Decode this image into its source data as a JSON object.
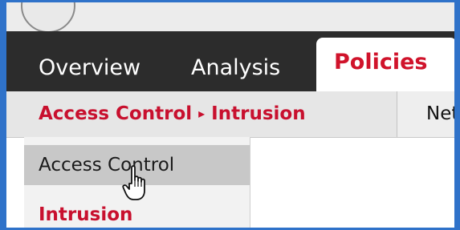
{
  "nav": {
    "tabs": [
      {
        "label": "Overview"
      },
      {
        "label": "Analysis"
      },
      {
        "label": "Policies"
      }
    ]
  },
  "breadcrumb": {
    "parent": "Access Control",
    "separator": "▸",
    "current": "Intrusion"
  },
  "subnav": {
    "next_tab_partial": "Net"
  },
  "dropdown": {
    "items": [
      {
        "label": "Access Control"
      },
      {
        "label": "Intrusion"
      }
    ]
  },
  "colors": {
    "frame": "#2f72c9",
    "navbar": "#2c2c2c",
    "accent": "#c8102e",
    "hover": "#c8c8c8"
  },
  "icons": {
    "cursor": "hand-pointer-icon"
  }
}
